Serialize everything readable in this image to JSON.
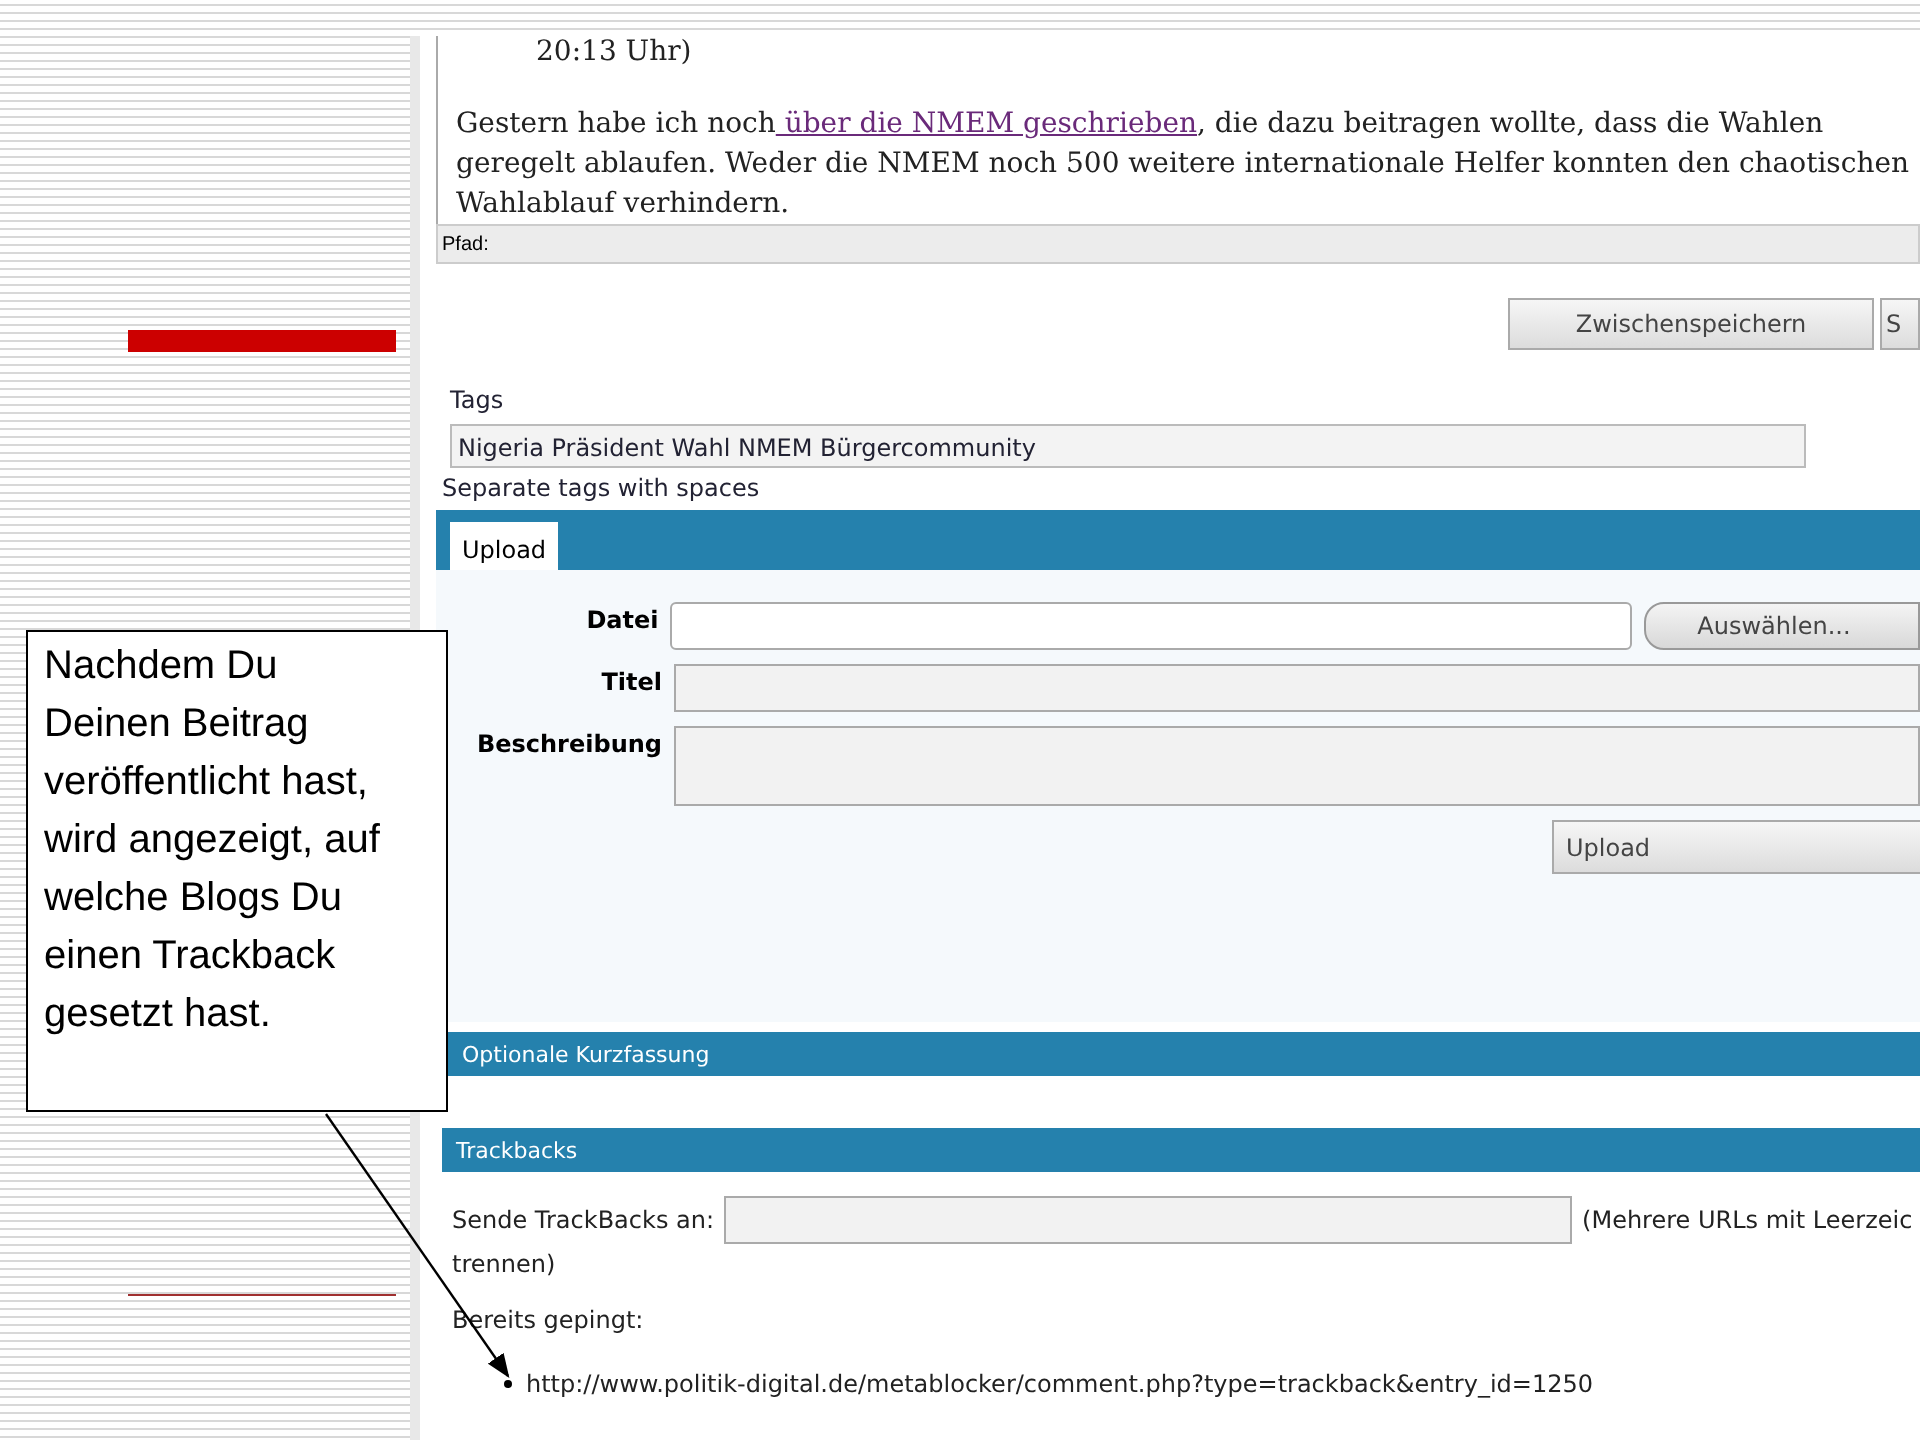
{
  "callout": "Nachdem Du Deinen Beitrag veröffentlicht hast, wird angezeigt, auf welche Blogs Du einen Trackback gesetzt hast.",
  "editor": {
    "time": "20:13 Uhr)",
    "text_before": "Gestern habe ich noch",
    "link": " über die NMEM geschrieben",
    "text_after": ", die dazu beitragen wollte, dass die Wahlen geregelt ablaufen. Weder die NMEM noch 500 weitere internationale Helfer konnten den chaotischen Wahlablauf verhindern.",
    "path_label": "Pfad:"
  },
  "buttons": [
    "Zwischenspeichern",
    "S"
  ],
  "tags": {
    "label": "Tags",
    "value": "Nigeria Präsident Wahl NMEM Bürgercommunity",
    "hint": "Separate tags with spaces"
  },
  "upload": {
    "tabs": [
      {
        "label": "Upload",
        "selected": true
      }
    ],
    "fields": [
      {
        "label": "Datei",
        "kind": "file",
        "button": "Auswählen..."
      },
      {
        "label": "Titel",
        "kind": "text"
      },
      {
        "label": "Beschreibung",
        "kind": "textarea"
      }
    ],
    "button": "Upload"
  },
  "summary": {
    "title": "Optionale Kurzfassung"
  },
  "trackbacks": {
    "title": "Trackbacks",
    "send_label": "Sende TrackBacks an:",
    "note": "(Mehrere URLs mit Leerzeic",
    "note_cont": "trennen)",
    "pinged_label": "Bereits gepingt:",
    "pinged": [
      "http://www.politik-digital.de/metablocker/comment.php?type=trackback&entry_id=1250"
    ]
  }
}
